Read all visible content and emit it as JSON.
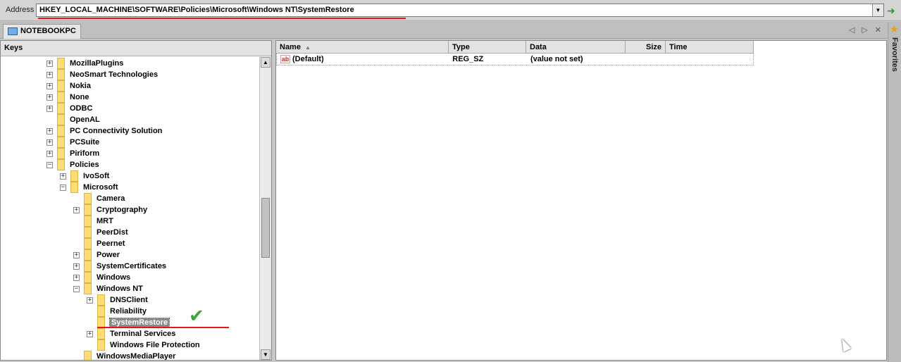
{
  "address": {
    "label": "Address",
    "path": "HKEY_LOCAL_MACHINE\\SOFTWARE\\Policies\\Microsoft\\Windows NT\\SystemRestore",
    "dropdown_glyph": "▼",
    "go_glyph": "➜"
  },
  "tabs": [
    {
      "label": "NOTEBOOKPC"
    }
  ],
  "tab_controls": {
    "prev": "◁",
    "next": "▷",
    "close": "✕"
  },
  "favorites": {
    "label": "Favorites",
    "icon": "star-icon"
  },
  "keys_pane": {
    "header": "Keys",
    "tree": [
      {
        "label": "MozillaPlugins",
        "expander": "+"
      },
      {
        "label": "NeoSmart Technologies",
        "expander": "+"
      },
      {
        "label": "Nokia",
        "expander": "+"
      },
      {
        "label": "None",
        "expander": "+"
      },
      {
        "label": "ODBC",
        "expander": "+"
      },
      {
        "label": "OpenAL",
        "expander": ""
      },
      {
        "label": "PC Connectivity Solution",
        "expander": "+"
      },
      {
        "label": "PCSuite",
        "expander": "+"
      },
      {
        "label": "Piriform",
        "expander": "+"
      },
      {
        "label": "Policies",
        "expander": "−"
      },
      {
        "label": "IvoSoft",
        "expander": "+"
      },
      {
        "label": "Microsoft",
        "expander": "−"
      },
      {
        "label": "Camera",
        "expander": ""
      },
      {
        "label": "Cryptography",
        "expander": "+"
      },
      {
        "label": "MRT",
        "expander": ""
      },
      {
        "label": "PeerDist",
        "expander": ""
      },
      {
        "label": "Peernet",
        "expander": ""
      },
      {
        "label": "Power",
        "expander": "+"
      },
      {
        "label": "SystemCertificates",
        "expander": "+"
      },
      {
        "label": "Windows",
        "expander": "+"
      },
      {
        "label": "Windows NT",
        "expander": "−"
      },
      {
        "label": "DNSClient",
        "expander": "+"
      },
      {
        "label": "Reliability",
        "expander": ""
      },
      {
        "label": "SystemRestore",
        "expander": "",
        "selected": true
      },
      {
        "label": "Terminal Services",
        "expander": "+"
      },
      {
        "label": "Windows File Protection",
        "expander": ""
      },
      {
        "label": "WindowsMediaPlayer",
        "expander": ""
      }
    ]
  },
  "values_pane": {
    "columns": [
      "Name",
      "Type",
      "Data",
      "Size",
      "Time"
    ],
    "sort_glyph": "▲",
    "rows": [
      {
        "name": "(Default)",
        "type": "REG_SZ",
        "data": "(value not set)",
        "size": "",
        "time": "",
        "icon": "string-value-icon",
        "icon_text": "ab"
      }
    ]
  },
  "annotations": {
    "check_glyph": "✔"
  },
  "colors": {
    "highlight_red": "#e0161b",
    "check_green": "#3ca53c",
    "folder_yellow": "#ffdd73"
  }
}
